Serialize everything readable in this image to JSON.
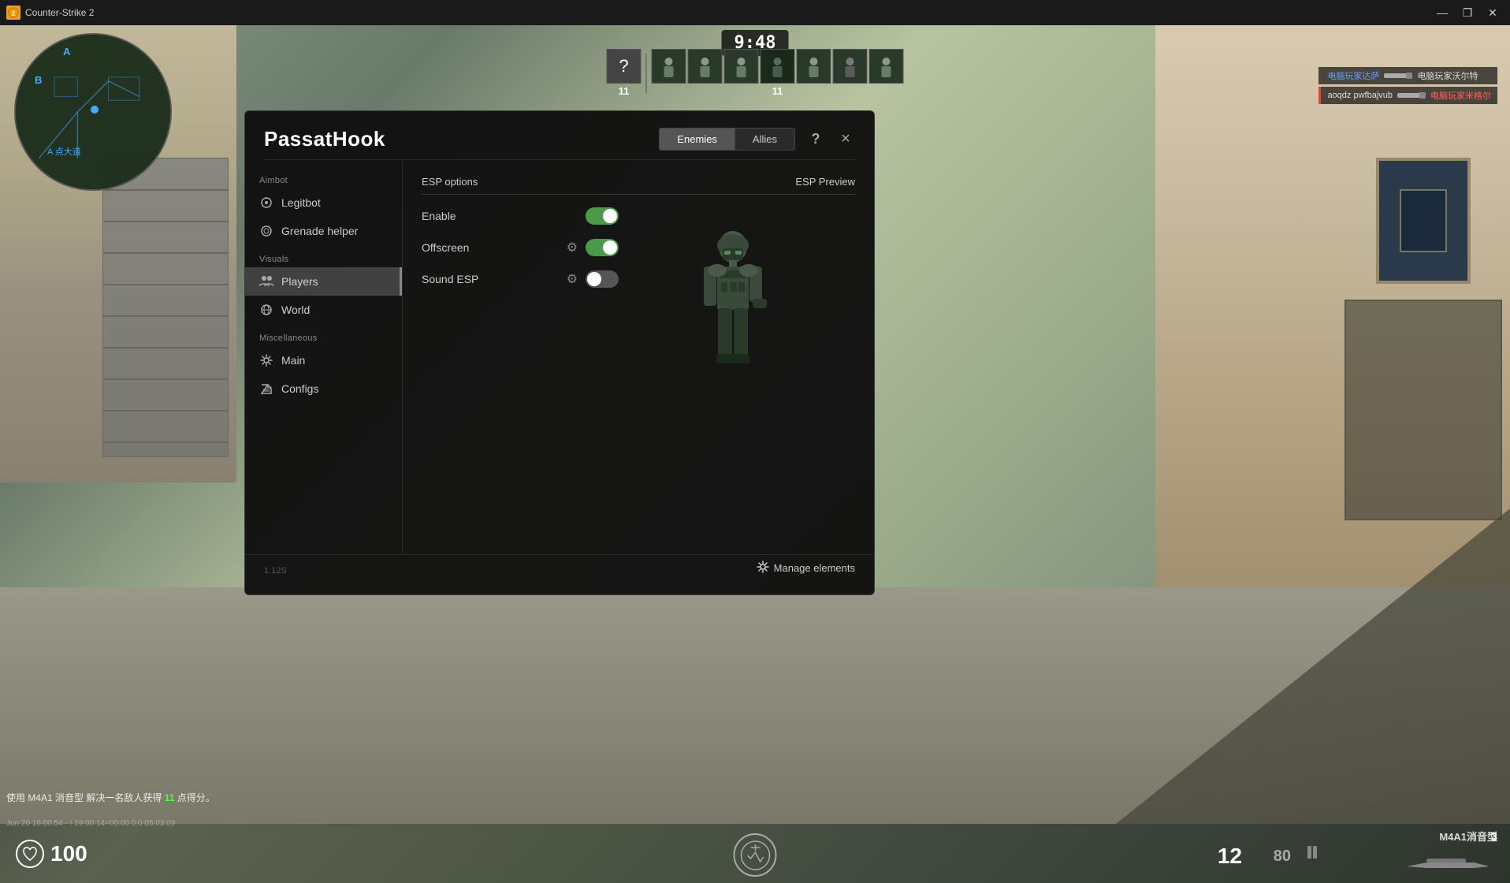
{
  "titlebar": {
    "icon": "CS2",
    "title": "Counter-Strike 2",
    "minimize_label": "—",
    "restore_label": "❐",
    "close_label": "✕"
  },
  "hud": {
    "timer": "9:48",
    "player_count_left": "11",
    "player_count_right": "11",
    "health": "100",
    "kills": "12",
    "armor": "80",
    "weapon_name": "M4A1消音型",
    "map_label_a": "A",
    "map_label_b": "B",
    "map_location": "A 点大道",
    "kill_message": "使用 M4A1 消音型 解决一名敌人获得 11 点得分。",
    "kill_points": "11",
    "datetime": "Jun 20 16:00:54 - ǃ 19:00:14=00:00 0:0 05:03:09",
    "number_right": "3"
  },
  "killfeed": [
    {
      "killer": "电脑玩家达萨",
      "weapon": "rifle",
      "victim": "电脑玩家沃尔特",
      "is_enemy": false
    },
    {
      "killer": "aoqdz pwfbajvub",
      "weapon": "rifle",
      "victim": "电脑玩家米格尔",
      "is_enemy": true
    }
  ],
  "dialog": {
    "title": "PassatHook",
    "tabs": [
      {
        "label": "Enemies",
        "active": true
      },
      {
        "label": "Allies",
        "active": false
      }
    ],
    "help_label": "?",
    "close_label": "×",
    "version": "1.12S",
    "manage_elements_label": "Manage elements",
    "sidebar": {
      "sections": [
        {
          "label": "Aimbot",
          "items": [
            {
              "id": "legitbot",
              "label": "Legitbot",
              "icon": "⊙",
              "active": false
            },
            {
              "id": "grenade-helper",
              "label": "Grenade helper",
              "icon": "●",
              "active": false
            }
          ]
        },
        {
          "label": "Visuals",
          "items": [
            {
              "id": "players",
              "label": "Players",
              "icon": "👥",
              "active": true
            },
            {
              "id": "world",
              "label": "World",
              "icon": "🌐",
              "active": false
            }
          ]
        },
        {
          "label": "Miscellaneous",
          "items": [
            {
              "id": "main",
              "label": "Main",
              "icon": "⚙",
              "active": false
            },
            {
              "id": "configs",
              "label": "Configs",
              "icon": "🔧",
              "active": false
            }
          ]
        }
      ]
    },
    "esp_options": {
      "section_title": "ESP options",
      "preview_title": "ESP Preview",
      "items": [
        {
          "id": "enable",
          "label": "Enable",
          "enabled": true,
          "has_gear": false
        },
        {
          "id": "offscreen",
          "label": "Offscreen",
          "enabled": true,
          "has_gear": true
        },
        {
          "id": "sound-esp",
          "label": "Sound ESP",
          "enabled": false,
          "has_gear": true
        }
      ]
    }
  }
}
